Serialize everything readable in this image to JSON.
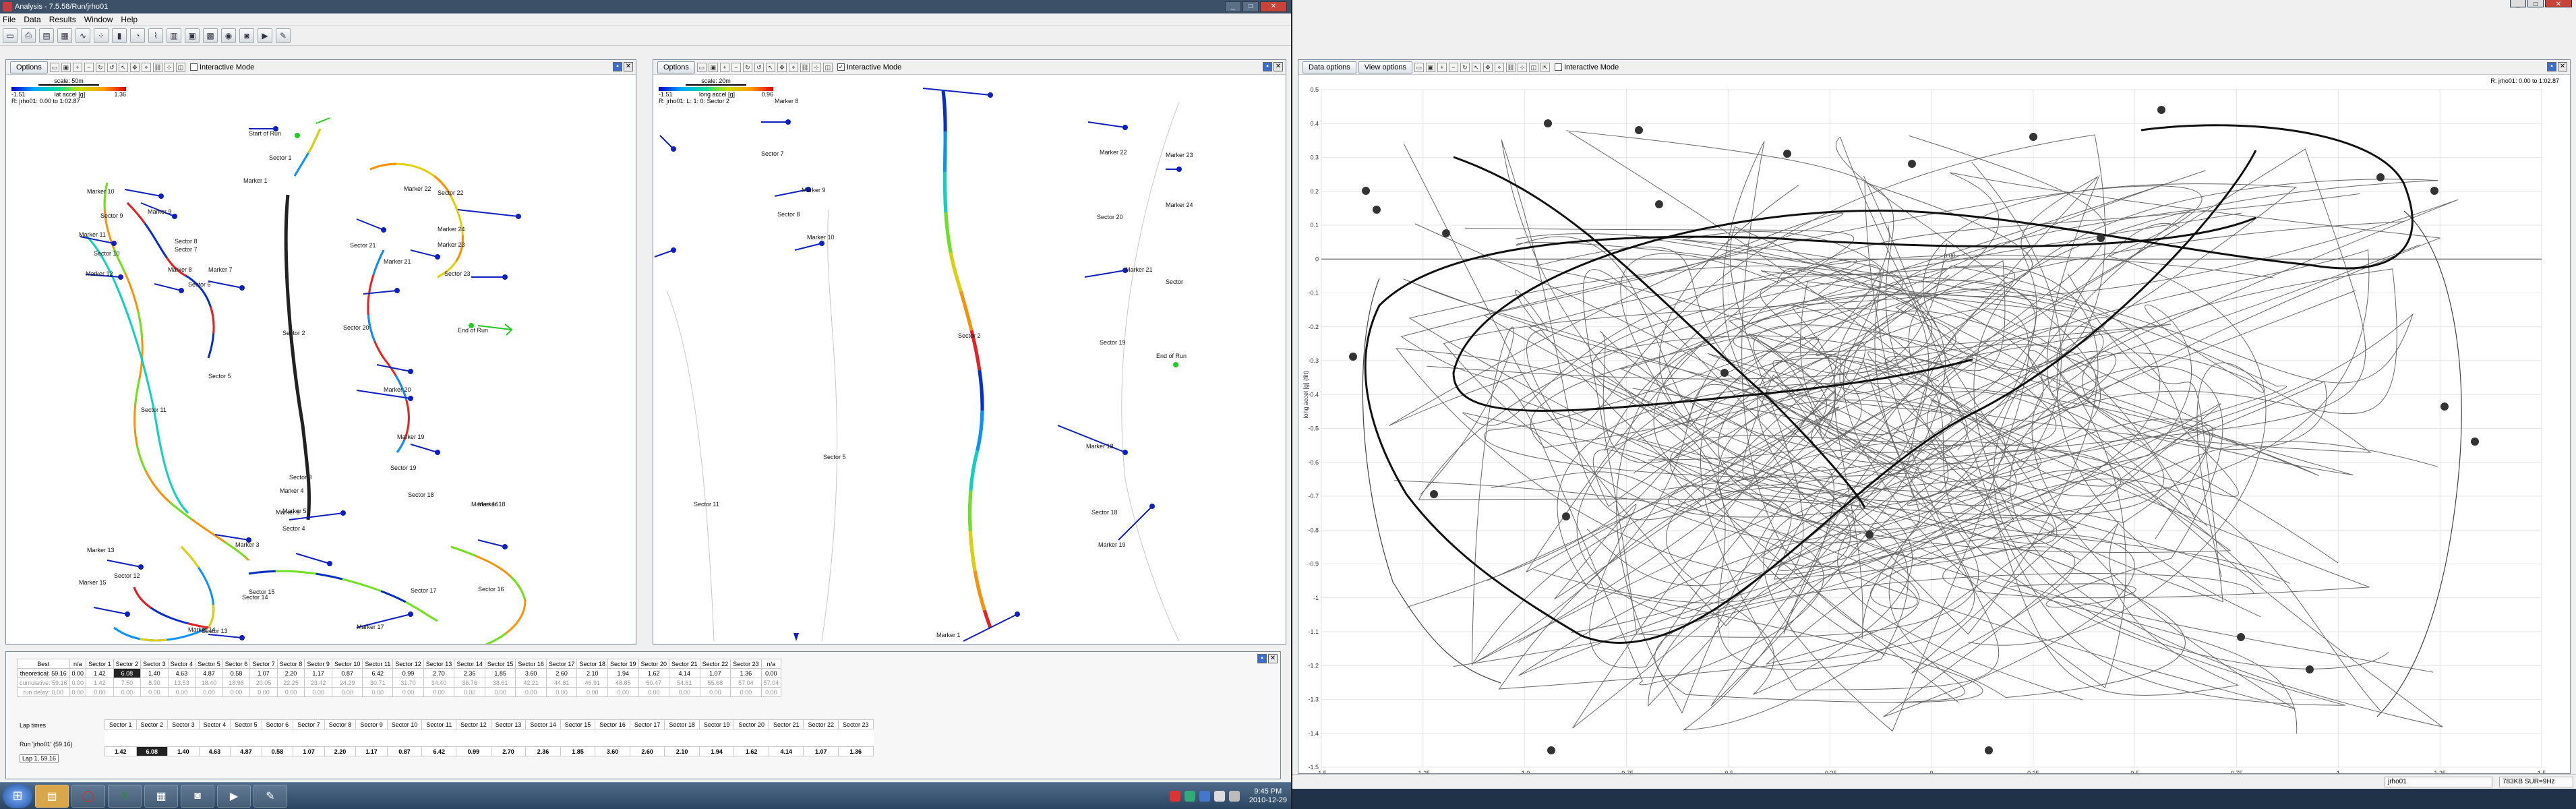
{
  "left_window": {
    "title": "Analysis - 7.5.58/Run/jrho01",
    "menu": [
      "File",
      "Data",
      "Results",
      "Window",
      "Help"
    ],
    "controls": {
      "min": "_",
      "max": "□",
      "close": "✕"
    }
  },
  "map_pane_1": {
    "options_label": "Options",
    "interactive_mode": "Interactive Mode",
    "scale_label": "scale: 50m",
    "legend_min": "-1.51",
    "legend_axis": "lat accel [g]",
    "legend_max": "1.36",
    "legend_range": "R: jrho01: 0.00 to 1:02.87",
    "labels": [
      "Start of Run",
      "Sector 1",
      "Marker 1",
      "Sector 2",
      "Marker 10",
      "Sector 9",
      "Marker 9",
      "Sector 8",
      "Marker 11",
      "Sector 10",
      "Marker 8",
      "Sector 7",
      "Marker 7",
      "Marker 12",
      "Sector 6",
      "Sector 11",
      "Sector 5",
      "Marker 6",
      "Marker 13",
      "Sector 12",
      "Marker 15",
      "Sector 14",
      "Marker 14",
      "Sector 13",
      "Marker 5",
      "Sector 4",
      "Marker 4",
      "Sector 3",
      "Marker 3",
      "Sector 15",
      "Marker 16",
      "Sector 16",
      "Marker 17",
      "Sector 17",
      "Marker 18",
      "Sector 18",
      "Marker 19",
      "Sector 19",
      "Marker 20",
      "Sector 20",
      "Marker 21",
      "Sector 21",
      "Marker 22",
      "Sector 22",
      "Marker 23",
      "Sector 23",
      "Marker 24",
      "End of Run"
    ]
  },
  "map_pane_2": {
    "options_label": "Options",
    "interactive_mode": "Interactive Mode",
    "scale_label": "scale: 20m",
    "legend_min": "-1.51",
    "legend_axis": "long accel [g]",
    "legend_max": "0.96",
    "legend_range": "R: jrho01: L: 1: 0: Sector 2",
    "labels": [
      "Marker 8",
      "Sector 7",
      "Marker 9",
      "Sector 8",
      "Marker 10",
      "Sector 2",
      "Sector 11",
      "Sector 5",
      "Marker 1",
      "Marker 22",
      "Sector 20",
      "Marker 21",
      "Sector 19",
      "Marker 18",
      "Sector 18",
      "Marker 19",
      "Marker 23",
      "Marker 24",
      "Sector",
      "End of Run"
    ]
  },
  "sector_table": {
    "header": [
      "Best",
      "n/a",
      "Sector 1",
      "Sector 2",
      "Sector 3",
      "Sector 4",
      "Sector 5",
      "Sector 6",
      "Sector 7",
      "Sector 8",
      "Sector 9",
      "Sector 10",
      "Sector 11",
      "Sector 12",
      "Sector 13",
      "Sector 14",
      "Sector 15",
      "Sector 16",
      "Sector 17",
      "Sector 18",
      "Sector 19",
      "Sector 20",
      "Sector 21",
      "Sector 22",
      "Sector 23",
      "n/a"
    ],
    "rows": [
      [
        "theoretical: 59.16",
        "0.00",
        "1.42",
        "6.08",
        "1.40",
        "4.63",
        "4.87",
        "0.58",
        "1.07",
        "2.20",
        "1.17",
        "0.87",
        "6.42",
        "0.99",
        "2.70",
        "2.36",
        "1.85",
        "3.60",
        "2.60",
        "2.10",
        "1.94",
        "1.62",
        "4.14",
        "1.07",
        "1.36",
        "0.00"
      ],
      [
        "cumulative: 59.16",
        "0.00",
        "1.42",
        "7.50",
        "8.90",
        "13.53",
        "18.40",
        "18.98",
        "20.05",
        "22.25",
        "23.42",
        "24.29",
        "30.71",
        "31.70",
        "34.40",
        "36.76",
        "38.61",
        "42.21",
        "44.81",
        "46.91",
        "48.85",
        "50.47",
        "54.61",
        "55.68",
        "57.04",
        "57.04"
      ],
      [
        "run delay: 0.00",
        "0.00",
        "0.00",
        "0.00",
        "0.00",
        "0.00",
        "0.00",
        "0.00",
        "0.00",
        "0.00",
        "0.00",
        "0.00",
        "0.00",
        "0.00",
        "0.00",
        "0.00",
        "0.00",
        "0.00",
        "0.00",
        "0.00",
        "0.00",
        "0.00",
        "0.00",
        "0.00",
        "0.00",
        "0.00"
      ]
    ]
  },
  "lap_table": {
    "title": "Lap times",
    "run_label": "Run 'jrho01' (59.16)",
    "lap_label": "Lap 1, 59.16",
    "header": [
      "Sector 1",
      "Sector 2",
      "Sector 3",
      "Sector 4",
      "Sector 5",
      "Sector 6",
      "Sector 7",
      "Sector 8",
      "Sector 9",
      "Sector 10",
      "Sector 11",
      "Sector 12",
      "Sector 13",
      "Sector 14",
      "Sector 15",
      "Sector 16",
      "Sector 17",
      "Sector 18",
      "Sector 19",
      "Sector 20",
      "Sector 21",
      "Sector 22",
      "Sector 23"
    ],
    "values": [
      "1.42",
      "6.08",
      "1.40",
      "4.63",
      "4.87",
      "0.58",
      "1.07",
      "2.20",
      "1.17",
      "0.87",
      "6.42",
      "0.99",
      "2.70",
      "2.36",
      "1.85",
      "3.60",
      "2.60",
      "2.10",
      "1.94",
      "1.62",
      "4.14",
      "1.07",
      "1.36"
    ]
  },
  "right_window": {
    "data_options": "Data options",
    "view_options": "View options",
    "interactive_mode": "Interactive Mode",
    "range_label": "R: jrho01: 0.00 to 1:02.87",
    "y_axis_label": "long accel [g] (filt)",
    "x_axis_label": "lat accel [g]",
    "origin_label": "0.00",
    "y_ticks": [
      "0.5",
      "0.4",
      "0.3",
      "0.2",
      "0.1",
      "0",
      "-0.1",
      "-0.2",
      "-0.3",
      "-0.4",
      "-0.5",
      "-0.6",
      "-0.7",
      "-0.8",
      "-0.9",
      "-1",
      "-1.1",
      "-1.2",
      "-1.3",
      "-1.4",
      "-1.5"
    ],
    "x_ticks": [
      "-1.5",
      "-1.25",
      "-1.0",
      "-0.75",
      "-0.5",
      "-0.25",
      "0",
      "0.25",
      "0.5",
      "0.75",
      "1",
      "1.25",
      "1.5"
    ],
    "status_run": "jrho01",
    "status_mem": "783KB SUR=9Hz"
  },
  "taskbar": {
    "time": "9:45 PM",
    "date": "2010-12-29"
  },
  "colors": {
    "accent": "#3c5068",
    "marker": "#1020c0",
    "trace": "#222222"
  }
}
